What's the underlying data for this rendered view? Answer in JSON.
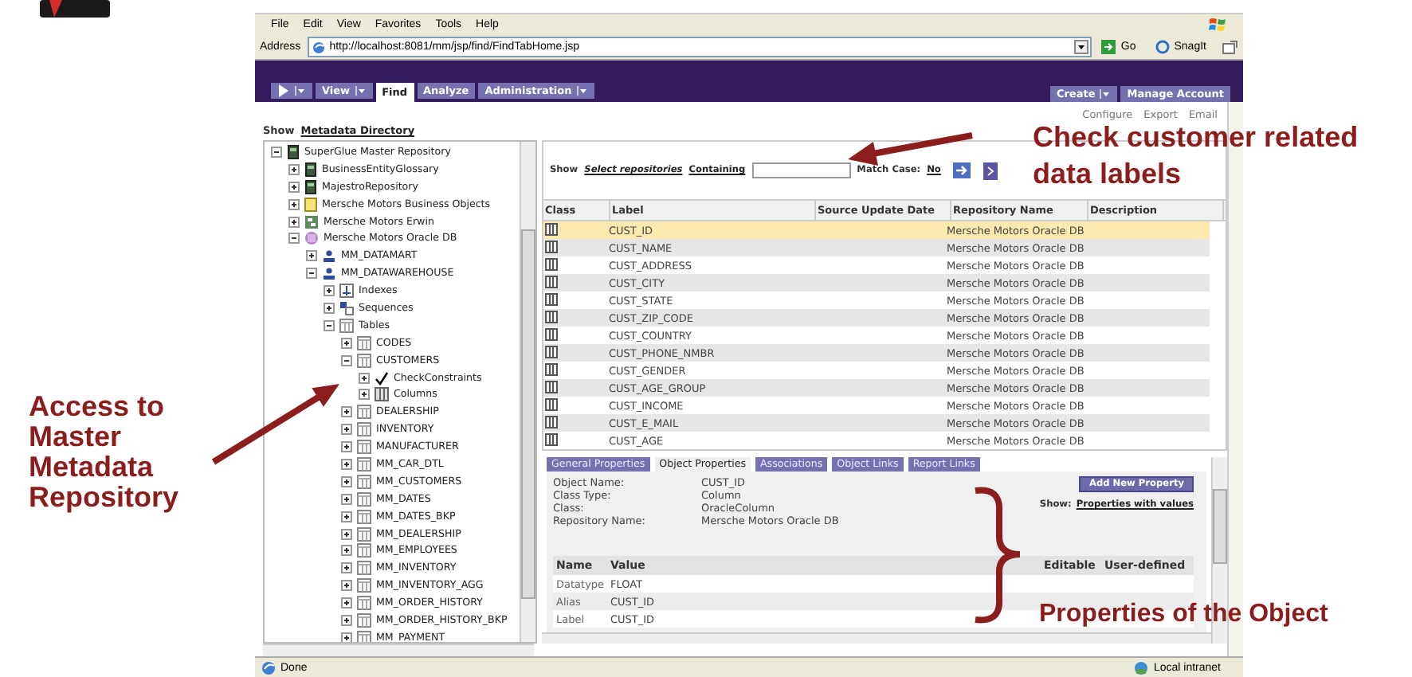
{
  "browser": {
    "menu": [
      "File",
      "Edit",
      "View",
      "Favorites",
      "Tools",
      "Help"
    ],
    "address_label": "Address",
    "url": "http://localhost:8081/mm/jsp/find/FindTabHome.jsp",
    "go": "Go",
    "toolbar_button": "SnagIt"
  },
  "nav": {
    "left": [
      {
        "kind": "play",
        "dropdown": true,
        "selected": false
      },
      {
        "kind": "text",
        "label": "View",
        "dropdown": true,
        "selected": false
      },
      {
        "kind": "text",
        "label": "Find",
        "dropdown": false,
        "selected": true
      },
      {
        "kind": "text",
        "label": "Analyze",
        "dropdown": false,
        "selected": false
      },
      {
        "kind": "text",
        "label": "Administration",
        "dropdown": true,
        "selected": false
      }
    ],
    "right": [
      {
        "kind": "text",
        "label": "Create",
        "dropdown": true,
        "selected": false
      },
      {
        "kind": "text",
        "label": "Manage Account",
        "dropdown": false,
        "selected": false
      }
    ]
  },
  "page_links": [
    "Configure",
    "Export",
    "Email"
  ],
  "show": {
    "label": "Show",
    "value": "Metadata Directory"
  },
  "tree": [
    {
      "label": "SuperGlue Master Repository",
      "kind": "repository",
      "expanded": true,
      "children": [
        {
          "label": "BusinessEntityGlossary",
          "kind": "repository",
          "expanded": false
        },
        {
          "label": "MajestroRepository",
          "kind": "repository",
          "expanded": false
        },
        {
          "label": "Mersche Motors Business Objects",
          "kind": "objects",
          "expanded": false
        },
        {
          "label": "Mersche Motors Erwin",
          "kind": "model",
          "expanded": false
        },
        {
          "label": "Mersche Motors Oracle DB",
          "kind": "database",
          "expanded": true,
          "children": [
            {
              "label": "MM_DATAMART",
              "kind": "schema",
              "expanded": false
            },
            {
              "label": "MM_DATAWAREHOUSE",
              "kind": "schema",
              "expanded": true,
              "children": [
                {
                  "label": "Indexes",
                  "kind": "indexes",
                  "expanded": false
                },
                {
                  "label": "Sequences",
                  "kind": "sequences",
                  "expanded": false
                },
                {
                  "label": "Tables",
                  "kind": "table",
                  "expanded": true,
                  "children": [
                    {
                      "label": "CODES",
                      "kind": "table",
                      "expanded": false
                    },
                    {
                      "label": "CUSTOMERS",
                      "kind": "table",
                      "expanded": true,
                      "children": [
                        {
                          "label": "CheckConstraints",
                          "kind": "check",
                          "expanded": false
                        },
                        {
                          "label": "Columns",
                          "kind": "columns",
                          "expanded": false
                        }
                      ]
                    },
                    {
                      "label": "DEALERSHIP",
                      "kind": "table",
                      "expanded": false
                    },
                    {
                      "label": "INVENTORY",
                      "kind": "table",
                      "expanded": false
                    },
                    {
                      "label": "MANUFACTURER",
                      "kind": "table",
                      "expanded": false
                    },
                    {
                      "label": "MM_CAR_DTL",
                      "kind": "table",
                      "expanded": false
                    },
                    {
                      "label": "MM_CUSTOMERS",
                      "kind": "table",
                      "expanded": false
                    },
                    {
                      "label": "MM_DATES",
                      "kind": "table",
                      "expanded": false
                    },
                    {
                      "label": "MM_DATES_BKP",
                      "kind": "table",
                      "expanded": false
                    },
                    {
                      "label": "MM_DEALERSHIP",
                      "kind": "table",
                      "expanded": false
                    },
                    {
                      "label": "MM_EMPLOYEES",
                      "kind": "table",
                      "expanded": false
                    },
                    {
                      "label": "MM_INVENTORY",
                      "kind": "table",
                      "expanded": false
                    },
                    {
                      "label": "MM_INVENTORY_AGG",
                      "kind": "table",
                      "expanded": false
                    },
                    {
                      "label": "MM_ORDER_HISTORY",
                      "kind": "table",
                      "expanded": false
                    },
                    {
                      "label": "MM_ORDER_HISTORY_BKP",
                      "kind": "table",
                      "expanded": false
                    },
                    {
                      "label": "MM_PAYMENT",
                      "kind": "table",
                      "expanded": false
                    }
                  ]
                }
              ]
            }
          ]
        }
      ]
    }
  ],
  "search": {
    "show_label": "Show",
    "repositories": "Select repositories",
    "containing": "Containing",
    "match_case_label": "Match Case:",
    "match_case_value": "No"
  },
  "results": {
    "columns": [
      "Class",
      "Label",
      "Source Update Date",
      "Repository Name",
      "Description"
    ],
    "rows": [
      {
        "label": "CUST_ID",
        "repository": "Mersche Motors Oracle DB",
        "selected": true
      },
      {
        "label": "CUST_NAME",
        "repository": "Mersche Motors Oracle DB",
        "selected": false
      },
      {
        "label": "CUST_ADDRESS",
        "repository": "Mersche Motors Oracle DB",
        "selected": false
      },
      {
        "label": "CUST_CITY",
        "repository": "Mersche Motors Oracle DB",
        "selected": false
      },
      {
        "label": "CUST_STATE",
        "repository": "Mersche Motors Oracle DB",
        "selected": false
      },
      {
        "label": "CUST_ZIP_CODE",
        "repository": "Mersche Motors Oracle DB",
        "selected": false
      },
      {
        "label": "CUST_COUNTRY",
        "repository": "Mersche Motors Oracle DB",
        "selected": false
      },
      {
        "label": "CUST_PHONE_NMBR",
        "repository": "Mersche Motors Oracle DB",
        "selected": false
      },
      {
        "label": "CUST_GENDER",
        "repository": "Mersche Motors Oracle DB",
        "selected": false
      },
      {
        "label": "CUST_AGE_GROUP",
        "repository": "Mersche Motors Oracle DB",
        "selected": false
      },
      {
        "label": "CUST_INCOME",
        "repository": "Mersche Motors Oracle DB",
        "selected": false
      },
      {
        "label": "CUST_E_MAIL",
        "repository": "Mersche Motors Oracle DB",
        "selected": false
      },
      {
        "label": "CUST_AGE",
        "repository": "Mersche Motors Oracle DB",
        "selected": false
      }
    ]
  },
  "details": {
    "tabs": [
      {
        "label": "General Properties",
        "selected": false
      },
      {
        "label": "Object Properties",
        "selected": true
      },
      {
        "label": "Associations",
        "selected": false
      },
      {
        "label": "Object Links",
        "selected": false
      },
      {
        "label": "Report Links",
        "selected": false
      }
    ],
    "fields": [
      {
        "name": "Object Name:",
        "value": "CUST_ID"
      },
      {
        "name": "Class Type:",
        "value": "Column"
      },
      {
        "name": "Class:",
        "value": "OracleColumn"
      },
      {
        "name": "Repository Name:",
        "value": "Mersche Motors Oracle DB"
      }
    ],
    "add_button": "Add New Property",
    "show_label": "Show:",
    "show_value": "Properties with values",
    "columns": [
      "Name",
      "Value",
      "Editable",
      "User-defined"
    ],
    "rows": [
      {
        "name": "Datatype",
        "value": "FLOAT"
      },
      {
        "name": "Alias",
        "value": "CUST_ID"
      },
      {
        "name": "Label",
        "value": "CUST_ID"
      }
    ]
  },
  "status_bar": {
    "text": "Done",
    "zone": "Local intranet"
  },
  "callouts": {
    "search": [
      "Check customer related",
      "data labels"
    ],
    "tree": [
      "Access to",
      "Master",
      "Metadata",
      "Repository"
    ],
    "properties": [
      "Properties of the Object"
    ]
  }
}
